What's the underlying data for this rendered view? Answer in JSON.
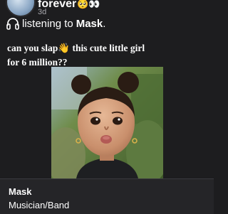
{
  "post": {
    "username": "forever",
    "username_emoji": "🥺👀",
    "timestamp": "3d",
    "listening": {
      "prefix": "listening to",
      "artist": "Mask",
      "suffix": ".",
      "icon": "headphones-icon"
    },
    "text_line1_before": "can you slap",
    "text_emoji": "👋",
    "text_line1_after": " this cute little girl",
    "text_line2": "for 6 million??",
    "image": "photo of a little girl pouting"
  },
  "card": {
    "title": "Mask",
    "subtitle": "Musician/Band"
  },
  "colors": {
    "background": "#1d1d1f",
    "card_background": "#252528",
    "muted_text": "#a8a8ad"
  }
}
